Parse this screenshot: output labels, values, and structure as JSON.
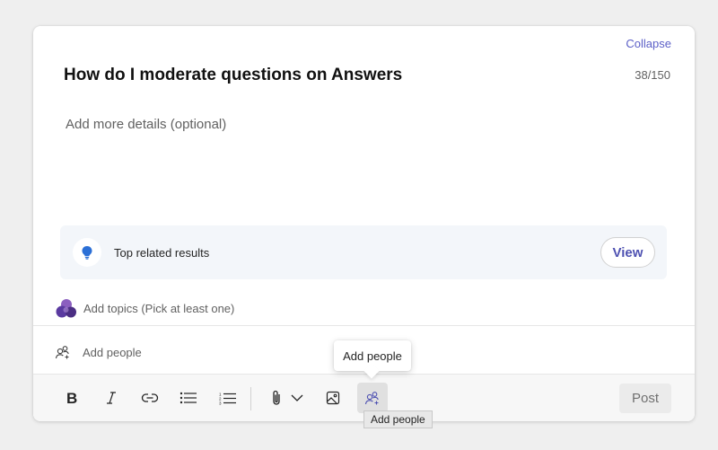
{
  "composer": {
    "collapse_label": "Collapse",
    "title": "How do I moderate questions on Answers",
    "char_count": "38/150",
    "details_placeholder": "Add more details (optional)"
  },
  "related": {
    "label": "Top related results",
    "view_label": "View",
    "icon": "lightbulb-icon",
    "accent_color": "#2b6fd6"
  },
  "topics": {
    "placeholder": "Add topics (Pick at least one)",
    "icon": "topics-icon"
  },
  "people": {
    "placeholder": "Add people",
    "icon": "add-people-icon"
  },
  "toolbar": {
    "buttons": [
      "bold-icon",
      "italic-icon",
      "link-icon",
      "bulleted-list-icon",
      "numbered-list-icon",
      "attach-icon",
      "chevron-down-icon",
      "image-icon",
      "add-people-icon"
    ],
    "post_label": "Post"
  },
  "tooltips": {
    "hover_label": "Add people",
    "native_label": "Add people"
  },
  "colors": {
    "brand": "#5b5fc7",
    "background": "#efefef"
  }
}
